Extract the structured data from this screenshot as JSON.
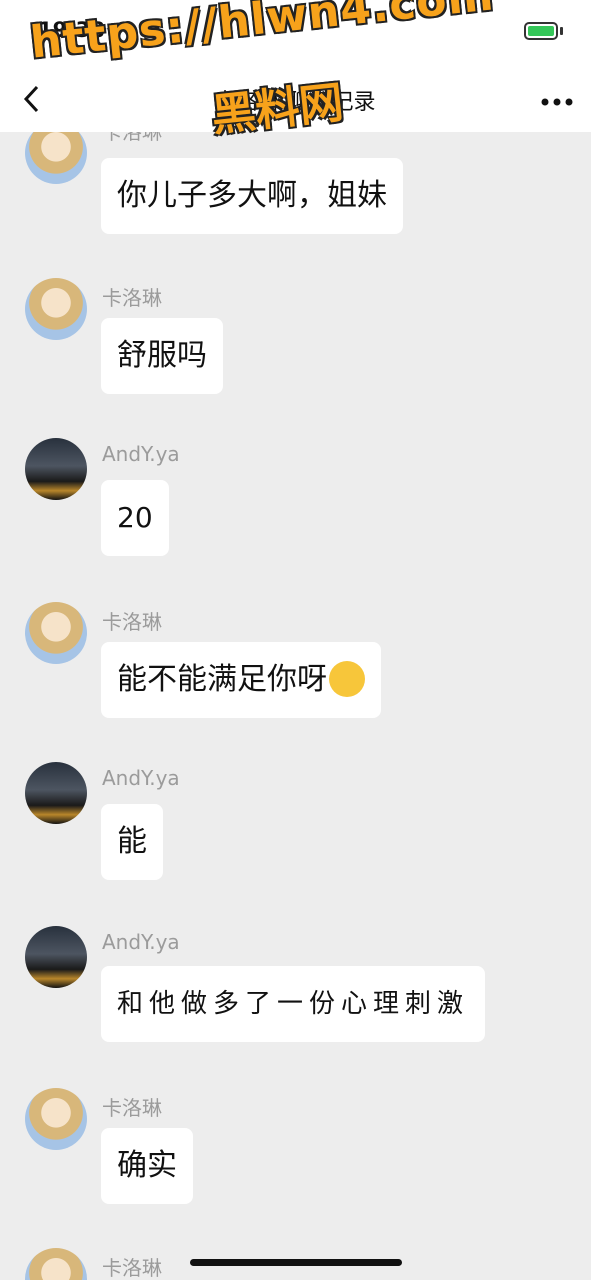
{
  "status_bar": {
    "time": "19:38"
  },
  "nav": {
    "title": "卡洛琳 聊天记录"
  },
  "watermark": {
    "url": "https://hlwn4.com",
    "cn": "黑料网"
  },
  "messages": [
    {
      "sender": "卡洛琳",
      "avatar": "girl-avatar",
      "text": "你儿子多大啊，姐妹"
    },
    {
      "sender": "卡洛琳",
      "avatar": "girl-avatar",
      "text": "舒服吗"
    },
    {
      "sender": "AndY.ya",
      "avatar": "city-avatar",
      "text": "20"
    },
    {
      "sender": "卡洛琳",
      "avatar": "girl-avatar",
      "text": "能不能满足你呀"
    },
    {
      "sender": "AndY.ya",
      "avatar": "city-avatar",
      "text": "能"
    },
    {
      "sender": "AndY.ya",
      "avatar": "city-avatar",
      "text": "和他做多了一份心理刺激"
    },
    {
      "sender": "卡洛琳",
      "avatar": "girl-avatar",
      "text": "确实"
    },
    {
      "sender": "卡洛琳",
      "avatar": "girl-avatar",
      "text": ""
    }
  ],
  "colors": {
    "chat_bg": "#ededed",
    "bubble_bg": "#ffffff",
    "sender_name": "#9b9b9b",
    "battery_green": "#35c759"
  },
  "icons": {
    "back": "chevron-left-icon",
    "more": "more-dots-icon",
    "location": "location-arrow-icon",
    "battery": "battery-icon",
    "emoji": "grinning-emoji-icon"
  }
}
